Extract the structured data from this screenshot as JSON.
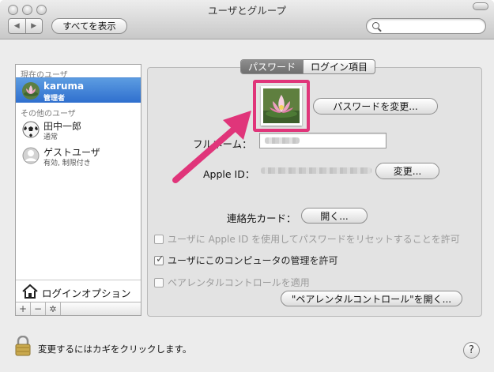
{
  "window": {
    "title": "ユーザとグループ"
  },
  "toolbar": {
    "back_glyph": "◀",
    "forward_glyph": "▶",
    "show_all_label": "すべてを表示",
    "search_placeholder": ""
  },
  "sidebar": {
    "current_user_header": "現在のユーザ",
    "other_users_header": "その他のユーザ",
    "users": [
      {
        "name": "karuma",
        "role": "管理者",
        "avatar": "lotus-avatar",
        "selected": true
      },
      {
        "name": "田中一郎",
        "role": "通常",
        "avatar": "soccer-ball-avatar",
        "selected": false
      },
      {
        "name": "ゲストユーザ",
        "role": "有効, 制限付き",
        "avatar": "guest-avatar",
        "selected": false
      }
    ],
    "login_options_label": "ログインオプション",
    "add_glyph": "+",
    "remove_glyph": "−",
    "gear_glyph": "✲"
  },
  "tabs": [
    {
      "label": "パスワード",
      "active": true
    },
    {
      "label": "ログイン項目",
      "active": false
    }
  ],
  "detail": {
    "change_password_label": "パスワードを変更...",
    "full_name_label": "フルネーム：",
    "apple_id_label": "Apple ID：",
    "change_label": "変更...",
    "contact_card_label": "連絡先カード：",
    "open_label": "開く...",
    "options": [
      {
        "label": "ユーザに Apple ID を使用してパスワードをリセットすることを許可",
        "checked": false,
        "enabled": false
      },
      {
        "label": "ユーザにこのコンピュータの管理を許可",
        "checked": true,
        "enabled": true
      },
      {
        "label": "ペアレンタルコントロールを適用",
        "checked": false,
        "enabled": false
      }
    ],
    "parental_open_label": "\"ペアレンタルコントロール\"を開く..."
  },
  "footer": {
    "lock_text": "変更するにはカギをクリックします。",
    "help_glyph": "?"
  },
  "colors": {
    "highlight": "#e0357a",
    "selection": "#3a7bd5"
  }
}
